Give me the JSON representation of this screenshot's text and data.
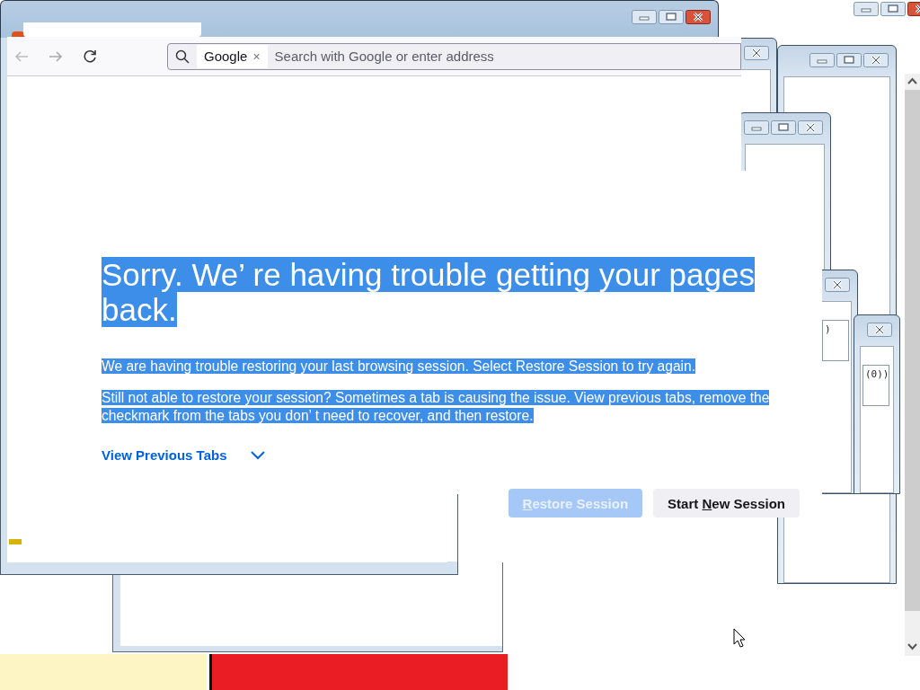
{
  "background_windows": [
    {
      "kind": "close_only"
    },
    {
      "kind": "full"
    },
    {
      "kind": "full"
    },
    {
      "kind": "close_only",
      "field_text": ")"
    },
    {
      "kind": "close_only",
      "field_text": "(0))"
    }
  ],
  "browser": {
    "search_engine_chip": {
      "label": "Google",
      "remove": "×"
    },
    "address_bar": {
      "placeholder": "Search with Google or enter address"
    },
    "page": {
      "text_selected": true,
      "heading": "Sorry. We’ re having trouble getting your pages back.",
      "paragraphs": [
        "We are having trouble restoring your last browsing session. Select Restore Session to try again.",
        "Still not able to restore your session? Sometimes a tab is causing the issue. View previous tabs, remove the checkmark from the tabs you don’ t need to recover, and then restore."
      ],
      "link": "View Previous Tabs",
      "buttons": [
        {
          "key": "R",
          "after": "estore Session",
          "disabled": true
        },
        {
          "before": "Start ",
          "key": "N",
          "after": "ew Session",
          "disabled": false
        }
      ]
    }
  }
}
